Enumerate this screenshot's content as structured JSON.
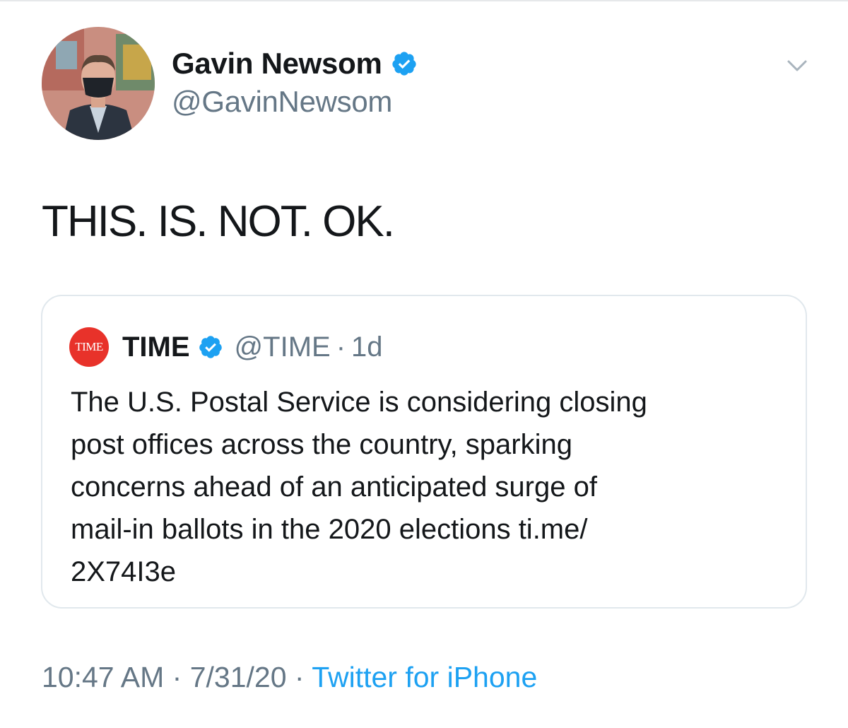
{
  "tweet": {
    "author": {
      "display_name": "Gavin Newsom",
      "handle": "@GavinNewsom",
      "verified": true
    },
    "text": "THIS. IS. NOT. OK.",
    "timestamp": "10:47 AM",
    "separator_1": "·",
    "date": "7/31/20",
    "separator_2": "·",
    "source": "Twitter for iPhone"
  },
  "quoted_tweet": {
    "logo_text": "TIME",
    "display_name": "TIME",
    "handle": "@TIME",
    "separator": "·",
    "age": "1d",
    "verified": true,
    "text": "The U.S. Postal Service is considering closing\npost offices across the country, sparking\nconcerns ahead of an anticipated surge of\nmail-in ballots in the 2020 elections ti.me/\n2X74I3e"
  },
  "icons": {
    "verified": "verified-badge-icon",
    "menu": "chevron-down-icon"
  },
  "colors": {
    "text_primary": "#14171a",
    "text_secondary": "#657786",
    "link": "#1da1f2",
    "verified": "#1da1f2",
    "border": "#e1e8ed",
    "time_logo": "#e8322a"
  }
}
